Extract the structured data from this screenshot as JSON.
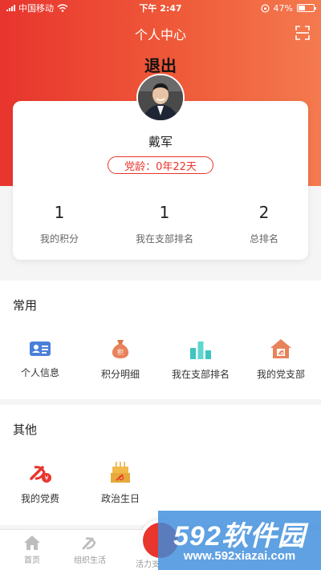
{
  "status_bar": {
    "carrier": "中国移动",
    "time": "下午 2:47",
    "battery": "47%",
    "battery_level": 0.47
  },
  "header": {
    "title": "个人中心",
    "logout": "退出",
    "scan_icon": "scan-icon"
  },
  "profile": {
    "name": "戴军",
    "party_age": "党龄：0年22天",
    "stats": [
      {
        "value": "1",
        "label": "我的积分"
      },
      {
        "value": "1",
        "label": "我在支部排名"
      },
      {
        "value": "2",
        "label": "总排名"
      }
    ]
  },
  "common": {
    "title": "常用",
    "items": [
      {
        "label": "个人信息",
        "icon": "id-card-icon"
      },
      {
        "label": "积分明细",
        "icon": "points-bag-icon"
      },
      {
        "label": "我在支部排名",
        "icon": "ranking-bars-icon"
      },
      {
        "label": "我的党支部",
        "icon": "party-branch-house-icon"
      }
    ]
  },
  "other": {
    "title": "其他",
    "items": [
      {
        "label": "我的党费",
        "icon": "party-fee-icon"
      },
      {
        "label": "政治生日",
        "icon": "birthday-cake-icon"
      }
    ]
  },
  "tabbar": {
    "items": [
      {
        "label": "首页",
        "icon": "home-icon"
      },
      {
        "label": "组织生活",
        "icon": "party-emblem-icon"
      },
      {
        "label": "活力支",
        "icon": "center-action-icon"
      }
    ]
  },
  "watermark": {
    "brand": "592软件园",
    "url": "www.592xiazai.com"
  },
  "colors": {
    "accent": "#e8352e",
    "accent_light": "#f47a4e",
    "icon_blue": "#4a7fd8",
    "icon_gold": "#e6a93a",
    "icon_teal": "#3ec5c0"
  }
}
